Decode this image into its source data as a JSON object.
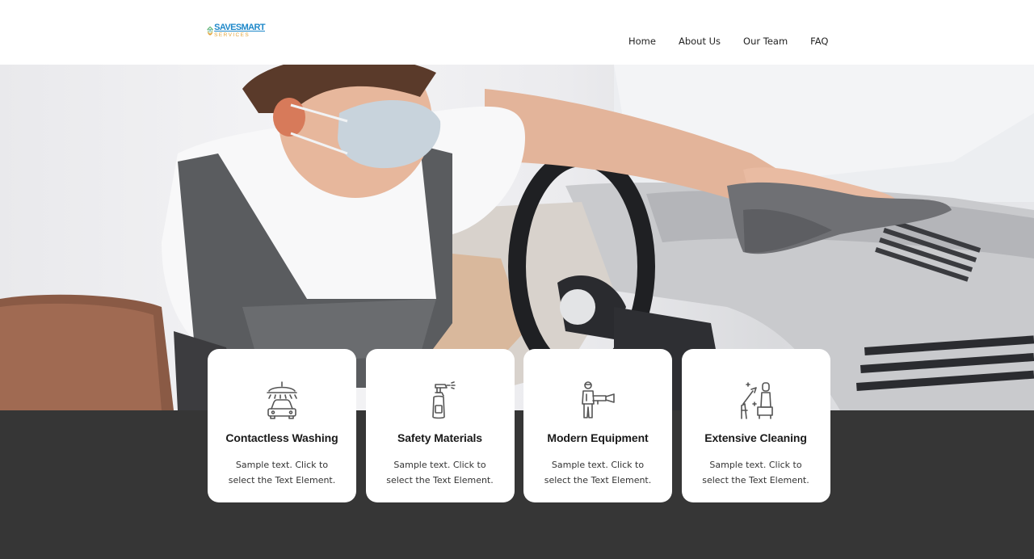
{
  "brand": {
    "logo_line1": "SAVESMART",
    "logo_line2": "SERVICES",
    "colors": {
      "primary": "#1e88c9",
      "accent": "#e0a33a",
      "roof": "#2e9d4a"
    }
  },
  "nav": {
    "items": [
      {
        "label": "Home"
      },
      {
        "label": "About Us"
      },
      {
        "label": "Our Team"
      },
      {
        "label": "FAQ"
      }
    ]
  },
  "hero": {
    "image": "man-with-face-mask-cleaning-car-interior-photo"
  },
  "features": [
    {
      "icon": "car-wash-icon",
      "title": "Contactless Washing",
      "text": "Sample text. Click to select the Text Element."
    },
    {
      "icon": "spray-bottle-icon",
      "title": "Safety Materials",
      "text": "Sample text. Click to select the Text Element."
    },
    {
      "icon": "pressure-washer-worker-icon",
      "title": "Modern Equipment",
      "text": "Sample text. Click to select the Text Element."
    },
    {
      "icon": "car-seat-cleaning-icon",
      "title": "Extensive Cleaning",
      "text": "Sample text. Click to select the Text Element."
    }
  ],
  "theme": {
    "dark_section": "#363636",
    "card_bg": "#ffffff"
  }
}
